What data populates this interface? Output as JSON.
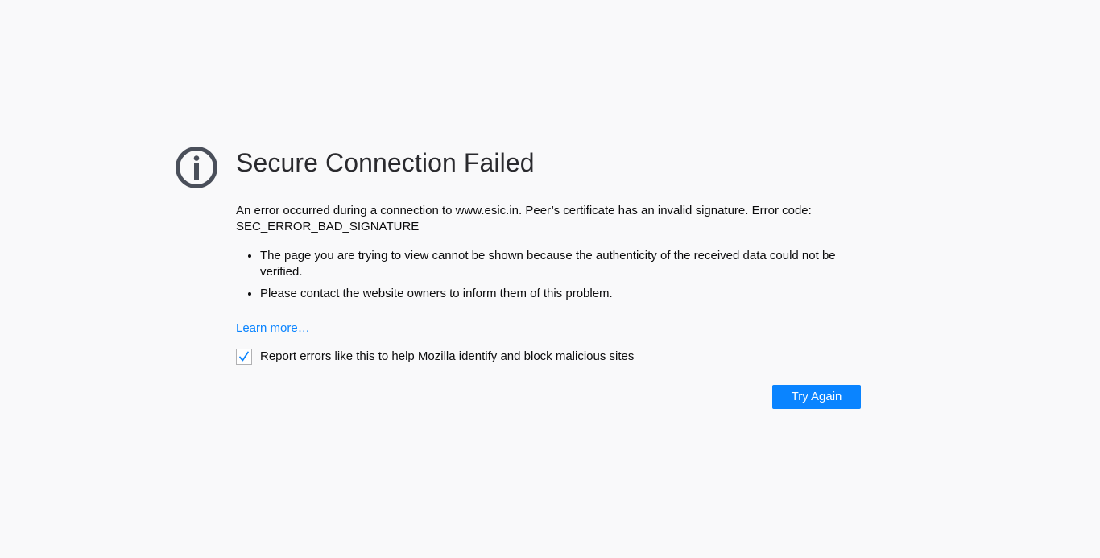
{
  "error_page": {
    "icon": "info-icon",
    "title": "Secure Connection Failed",
    "description_line1": "An error occurred during a connection to www.esic.in. Peer’s certificate has an invalid signature. Error code:",
    "error_code": "SEC_ERROR_BAD_SIGNATURE",
    "bullets": [
      "The page you are trying to view cannot be shown because the authenticity of the received data could not be verified.",
      "Please contact the website owners to inform them of this problem."
    ],
    "learn_more": "Learn more…",
    "report_checkbox": {
      "label": "Report errors like this to help Mozilla identify and block malicious sites",
      "checked": true
    },
    "try_again_label": "Try Again"
  },
  "colors": {
    "background": "#f9f9fa",
    "accent": "#0a84ff",
    "icon": "#4a4f5a"
  }
}
